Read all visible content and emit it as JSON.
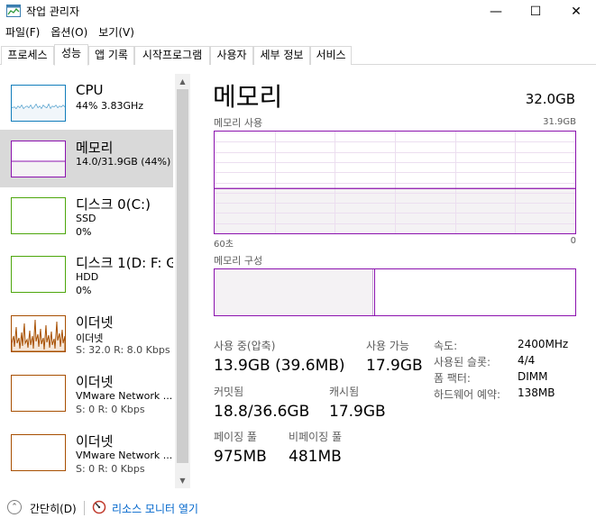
{
  "window": {
    "title": "작업 관리자",
    "controls": {
      "minimize": "—",
      "maximize": "☐",
      "close": "✕"
    }
  },
  "menu": [
    {
      "label": "파일(F)"
    },
    {
      "label": "옵션(O)"
    },
    {
      "label": "보기(V)"
    }
  ],
  "tabs": [
    {
      "label": "프로세스",
      "active": false
    },
    {
      "label": "성능",
      "active": true
    },
    {
      "label": "앱 기록",
      "active": false
    },
    {
      "label": "시작프로그램",
      "active": false
    },
    {
      "label": "사용자",
      "active": false
    },
    {
      "label": "세부 정보",
      "active": false
    },
    {
      "label": "서비스",
      "active": false
    }
  ],
  "sidebar": {
    "items": [
      {
        "title": "CPU",
        "line1": "44%  3.83GHz",
        "line2": "",
        "color": "#117dbb",
        "selected": false
      },
      {
        "title": "메모리",
        "line1": "14.0/31.9GB (44%)",
        "line2": "",
        "color": "#8b12ae",
        "selected": true
      },
      {
        "title": "디스크 0(C:)",
        "line1": "SSD",
        "line2": "0%",
        "color": "#4da60c",
        "selected": false
      },
      {
        "title": "디스크 1(D: F: G",
        "line1": "HDD",
        "line2": "0%",
        "color": "#4da60c",
        "selected": false
      },
      {
        "title": "이더넷",
        "line1": "이더넷",
        "line2": "S: 32.0  R: 8.0 Kbps",
        "color": "#a74f01",
        "selected": false
      },
      {
        "title": "이더넷",
        "line1": "VMware Network ...",
        "line2": "S: 0  R: 0 Kbps",
        "color": "#a74f01",
        "selected": false
      },
      {
        "title": "이더넷",
        "line1": "VMware Network ...",
        "line2": "S: 0  R: 0 Kbps",
        "color": "#a74f01",
        "selected": false
      }
    ]
  },
  "scrollbar": {
    "up": "▲",
    "down": "▼"
  },
  "main": {
    "title": "메모리",
    "total": "32.0GB",
    "usage_chart": {
      "label": "메모리 사용",
      "max_label": "31.9GB",
      "x_left_label": "60초",
      "x_right_label": "0",
      "used_fraction": 0.44
    },
    "composition": {
      "label": "메모리 구성",
      "in_use_fraction": 0.44,
      "modified_fraction": 0.005
    },
    "stats": {
      "in_use_label": "사용 중(압축)",
      "in_use_value": "13.9GB (39.6MB)",
      "available_label": "사용 가능",
      "available_value": "17.9GB",
      "committed_label": "커밋됨",
      "committed_value": "18.8/36.6GB",
      "cached_label": "캐시됨",
      "cached_value": "17.9GB",
      "paged_label": "페이징 풀",
      "paged_value": "975MB",
      "nonpaged_label": "비페이징 풀",
      "nonpaged_value": "481MB"
    },
    "specs": [
      {
        "label": "속도:",
        "value": "2400MHz"
      },
      {
        "label": "사용된 슬롯:",
        "value": "4/4"
      },
      {
        "label": "폼 팩터:",
        "value": "DIMM"
      },
      {
        "label": "하드웨어 예약:",
        "value": "138MB"
      }
    ]
  },
  "footer": {
    "fewer_details": "간단히(D)",
    "open_resmon": "리소스 모니터 열기"
  }
}
